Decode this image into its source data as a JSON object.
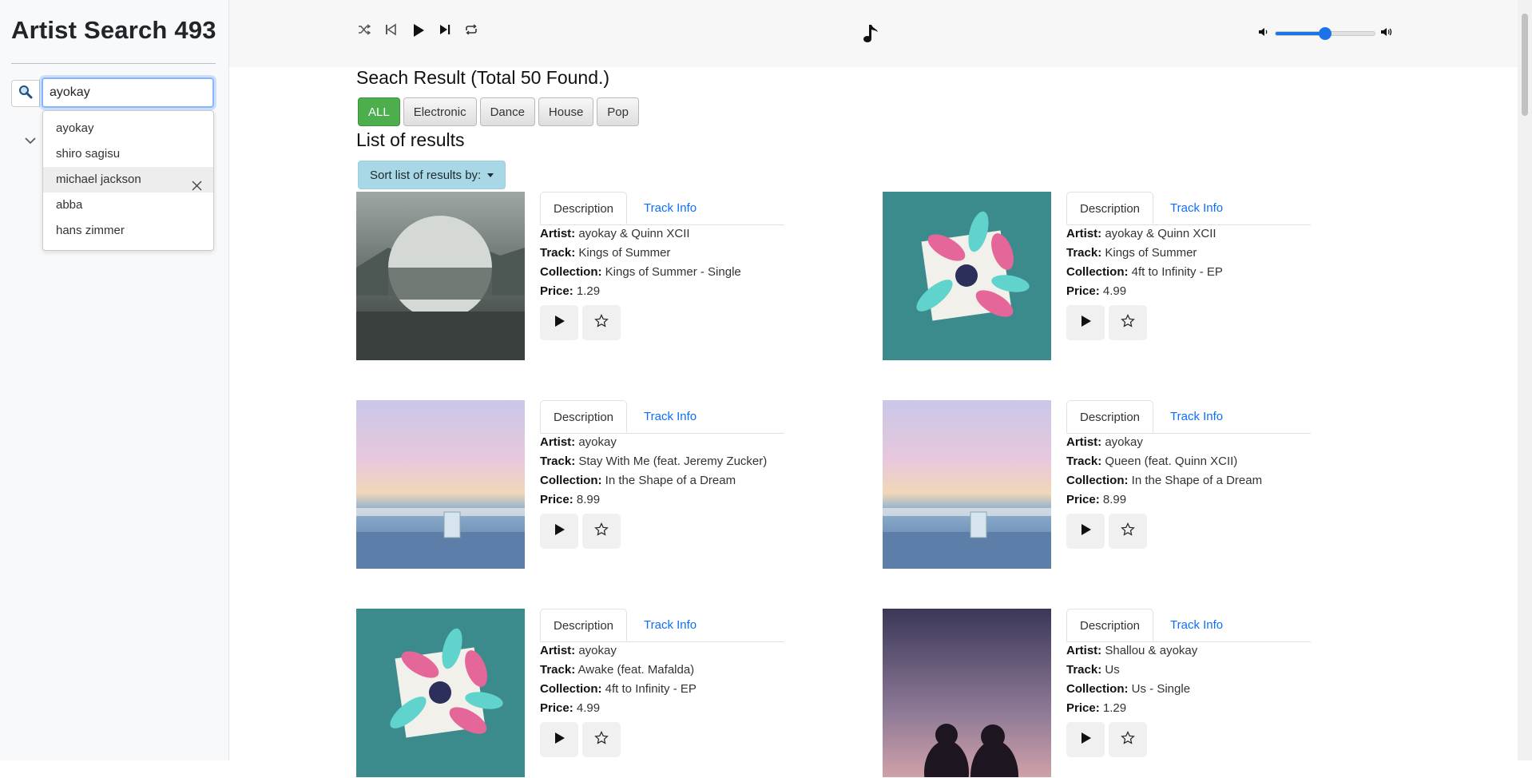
{
  "app": {
    "title": "Artist Search 493"
  },
  "search": {
    "value": "ayokay"
  },
  "suggestions": [
    "ayokay",
    "shiro sagisu",
    "michael jackson",
    "abba",
    "hans zimmer"
  ],
  "player": {
    "volume_percent": 50
  },
  "results": {
    "heading": "Seach Result (Total 50 Found.)",
    "list_heading": "List of results",
    "sort_label": "Sort list of results by:",
    "genres": [
      "ALL",
      "Electronic",
      "Dance",
      "House",
      "Pop"
    ],
    "active_genre": "ALL"
  },
  "labels": {
    "artist": "Artist:",
    "track": "Track:",
    "collection": "Collection:",
    "price": "Price:",
    "tab_description": "Description",
    "tab_track_info": "Track Info"
  },
  "tracks": [
    {
      "artist": "ayokay & Quinn XCII",
      "track": "Kings of Summer",
      "collection": "Kings of Summer - Single",
      "price": "1.29",
      "art": "kings-of-summer"
    },
    {
      "artist": "ayokay & Quinn XCII",
      "track": "Kings of Summer",
      "collection": "4ft to Infinity - EP",
      "price": "4.99",
      "art": "4ft-to-infinity"
    },
    {
      "artist": "ayokay",
      "track": "Stay With Me (feat. Jeremy Zucker)",
      "collection": "In the Shape of a Dream",
      "price": "8.99",
      "art": "shape-of-a-dream"
    },
    {
      "artist": "ayokay",
      "track": "Queen (feat. Quinn XCII)",
      "collection": "In the Shape of a Dream",
      "price": "8.99",
      "art": "shape-of-a-dream"
    },
    {
      "artist": "ayokay",
      "track": "Awake (feat. Mafalda)",
      "collection": "4ft to Infinity - EP",
      "price": "4.99",
      "art": "4ft-to-infinity"
    },
    {
      "artist": "Shallou & ayokay",
      "track": "Us",
      "collection": "Us - Single",
      "price": "1.29",
      "art": "us-single"
    }
  ]
}
